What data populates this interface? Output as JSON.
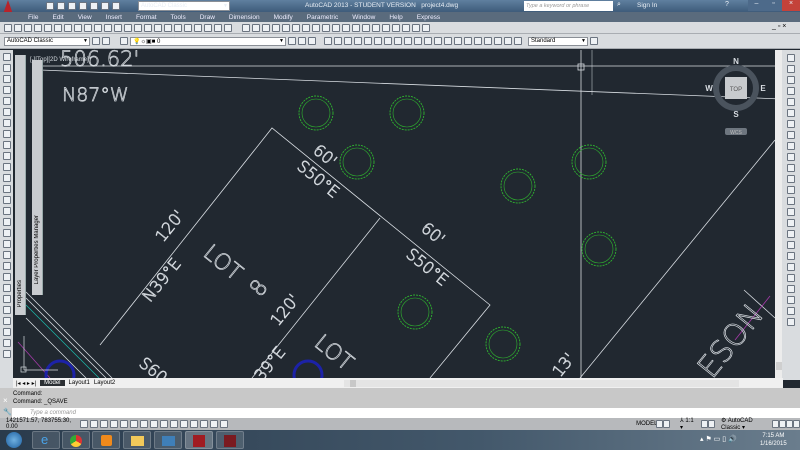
{
  "title": {
    "app": "AutoCAD 2013 - STUDENT VERSION",
    "file": "project4.dwg",
    "workspace": "AutoCAD Classic",
    "search_placeholder": "Type a keyword or phrase",
    "sign_in": "Sign In"
  },
  "menu": [
    "File",
    "Edit",
    "View",
    "Insert",
    "Format",
    "Tools",
    "Draw",
    "Dimension",
    "Modify",
    "Parametric",
    "Window",
    "Help",
    "Express"
  ],
  "toolbar": {
    "workspace_combo": "AutoCAD Classic",
    "layer_combo": "0",
    "style_combo": "Standard"
  },
  "viewport": {
    "label": "[-][Top][2D Wireframe]"
  },
  "panels": {
    "properties": "Properties",
    "layers": "Layer Properties Manager"
  },
  "drawing": {
    "texts": [
      "506.62'",
      "N87°W",
      "60'",
      "S50°E",
      "120'",
      "N39°E",
      "LOT",
      "8",
      "120'",
      "60'",
      "S50°E",
      "S60",
      "39°E",
      "LOT",
      "ESON",
      "13'"
    ]
  },
  "viewcube": {
    "n": "N",
    "s": "S",
    "e": "E",
    "w": "W",
    "top": "TOP",
    "wcs": "WCS"
  },
  "layout_tabs": [
    "Model",
    "Layout1",
    "Layout2"
  ],
  "command": {
    "history": [
      "Command:",
      "Command:  _QSAVE"
    ],
    "placeholder": "Type  a  command"
  },
  "status": {
    "coords": "1421571.57, 783755.30, 0.00",
    "model": "MODEL",
    "scale": "1:1",
    "workspace": "AutoCAD Classic"
  },
  "taskbar": {
    "time": "7:15 AM",
    "date": "1/16/2015"
  },
  "colors": {
    "canvas": "#212830",
    "tree": "#2fb52f",
    "lines": "#d8dde2"
  }
}
